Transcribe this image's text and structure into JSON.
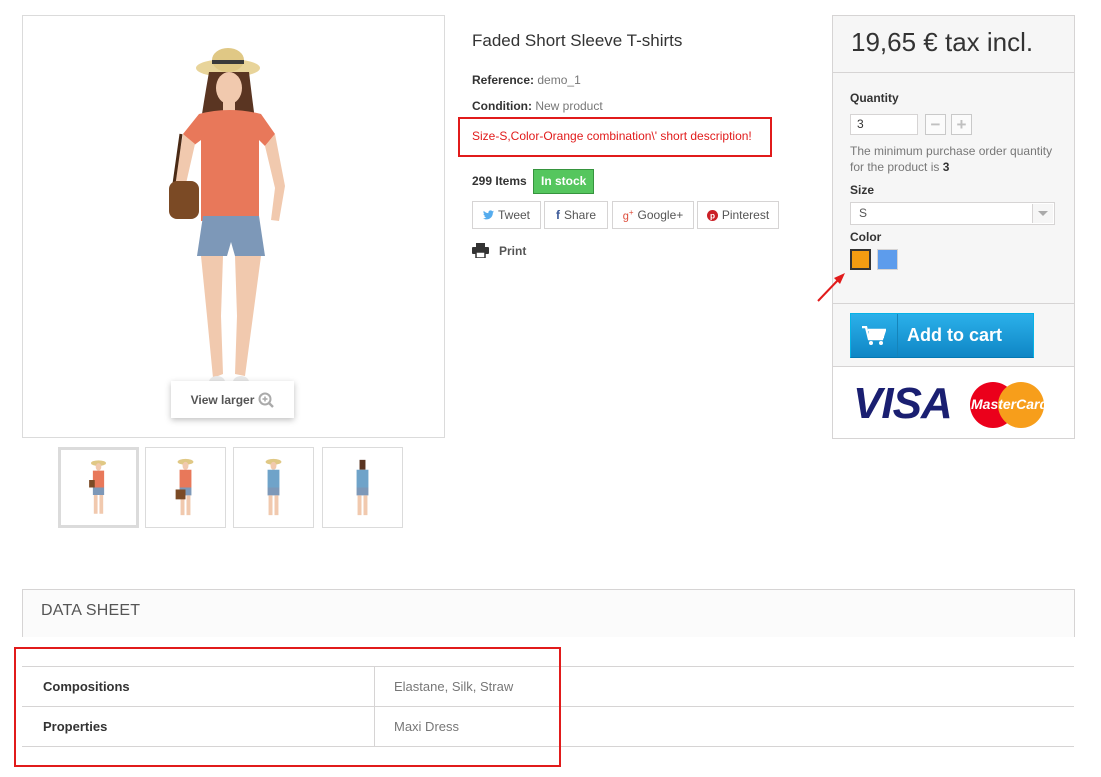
{
  "product": {
    "title": "Faded Short Sleeve T-shirts",
    "reference_label": "Reference:",
    "reference_value": "demo_1",
    "condition_label": "Condition:",
    "condition_value": "New product",
    "short_description": "Size-S,Color-Orange combination\\' short description!",
    "items_count": "299 Items",
    "stock_badge": "In stock",
    "view_larger": "View larger"
  },
  "social": {
    "tweet": "Tweet",
    "share": "Share",
    "google": "Google+",
    "pinterest": "Pinterest",
    "print": "Print"
  },
  "buybox": {
    "price": "19,65 € tax incl.",
    "quantity_label": "Quantity",
    "quantity_value": "3",
    "min_qty_text": "The minimum purchase order quantity for the product is",
    "min_qty_value": "3",
    "size_label": "Size",
    "size_selected": "S",
    "color_label": "Color",
    "colors": [
      "#f39c11",
      "#5d9cec"
    ],
    "add_to_cart": "Add to cart",
    "payment_visa": "VISA",
    "payment_mastercard": "MasterCard"
  },
  "datasheet": {
    "title": "DATA SHEET",
    "rows": [
      {
        "key": "Compositions",
        "value": "Elastane, Silk, Straw"
      },
      {
        "key": "Properties",
        "value": "Maxi Dress"
      }
    ]
  },
  "colors": {
    "highlight_red": "#e11b1b",
    "stock_green": "#55c65e",
    "cart_blue": "#1b9ad6"
  }
}
